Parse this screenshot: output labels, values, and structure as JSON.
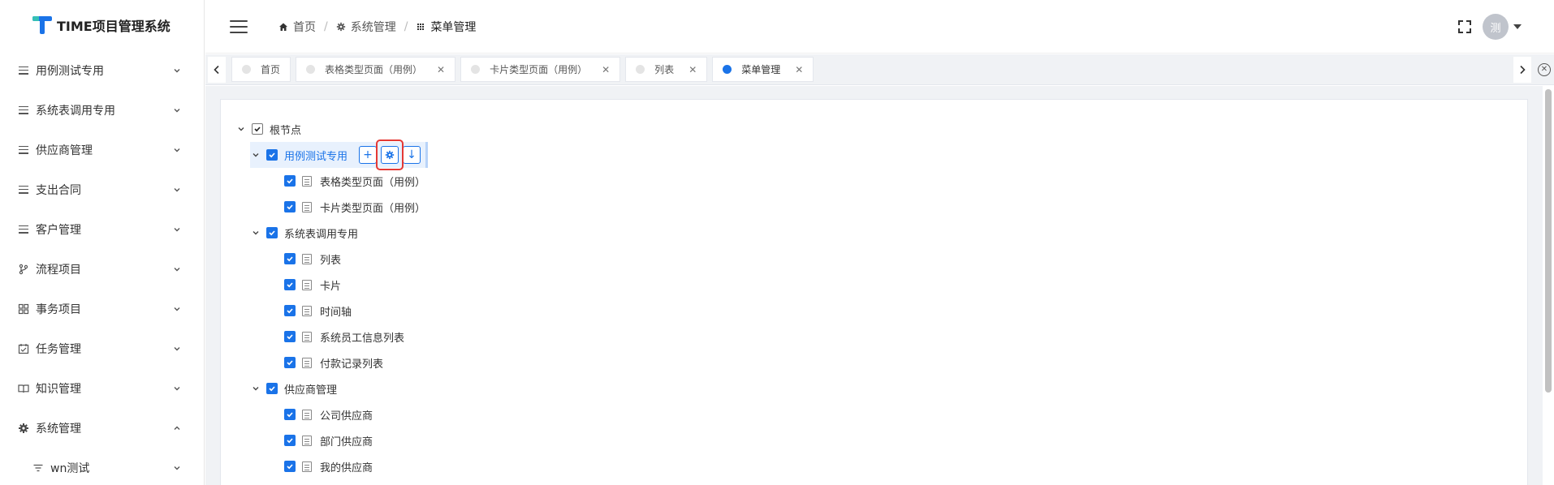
{
  "app": {
    "logo_text": "TIME项目管理系统"
  },
  "sidebar": {
    "items": [
      {
        "label": "用例测试专用",
        "icon": "lines-icon",
        "expanded": false
      },
      {
        "label": "系统表调用专用",
        "icon": "lines-icon",
        "expanded": false
      },
      {
        "label": "供应商管理",
        "icon": "lines-icon",
        "expanded": false
      },
      {
        "label": "支出合同",
        "icon": "lines-icon",
        "expanded": false
      },
      {
        "label": "客户管理",
        "icon": "lines-icon",
        "expanded": false
      },
      {
        "label": "流程项目",
        "icon": "branch-icon",
        "expanded": false
      },
      {
        "label": "事务项目",
        "icon": "grid-icon",
        "expanded": false
      },
      {
        "label": "任务管理",
        "icon": "calendar-check-icon",
        "expanded": false
      },
      {
        "label": "知识管理",
        "icon": "book-icon",
        "expanded": false
      },
      {
        "label": "系统管理",
        "icon": "gear-icon",
        "expanded": true
      },
      {
        "label": "wn测试",
        "icon": "filter-icon",
        "expanded": false
      }
    ]
  },
  "header": {
    "breadcrumb": [
      {
        "label": "首页",
        "icon": "home-icon"
      },
      {
        "label": "系统管理",
        "icon": "gear-icon"
      },
      {
        "label": "菜单管理",
        "icon": "grid-dots-icon"
      }
    ],
    "avatar_text": "测"
  },
  "tabs": [
    {
      "label": "首页",
      "active": false,
      "closable": false
    },
    {
      "label": "表格类型页面（用例）",
      "active": false,
      "closable": true
    },
    {
      "label": "卡片类型页面（用例）",
      "active": false,
      "closable": true
    },
    {
      "label": "列表",
      "active": false,
      "closable": true
    },
    {
      "label": "菜单管理",
      "active": true,
      "closable": true
    }
  ],
  "tree": {
    "root": "根节点",
    "groups": [
      {
        "label": "用例测试专用",
        "selected": true,
        "children": [
          "表格类型页面（用例）",
          "卡片类型页面（用例）"
        ]
      },
      {
        "label": "系统表调用专用",
        "selected": false,
        "children": [
          "列表",
          "卡片",
          "时间轴",
          "系统员工信息列表",
          "付款记录列表"
        ]
      },
      {
        "label": "供应商管理",
        "selected": false,
        "children": [
          "公司供应商",
          "部门供应商",
          "我的供应商"
        ]
      }
    ],
    "actions": {
      "add": "+",
      "settings": "settings-icon",
      "move_down": "↓"
    }
  },
  "colors": {
    "accent": "#1a73e8",
    "highlight_box": "#e53935"
  }
}
